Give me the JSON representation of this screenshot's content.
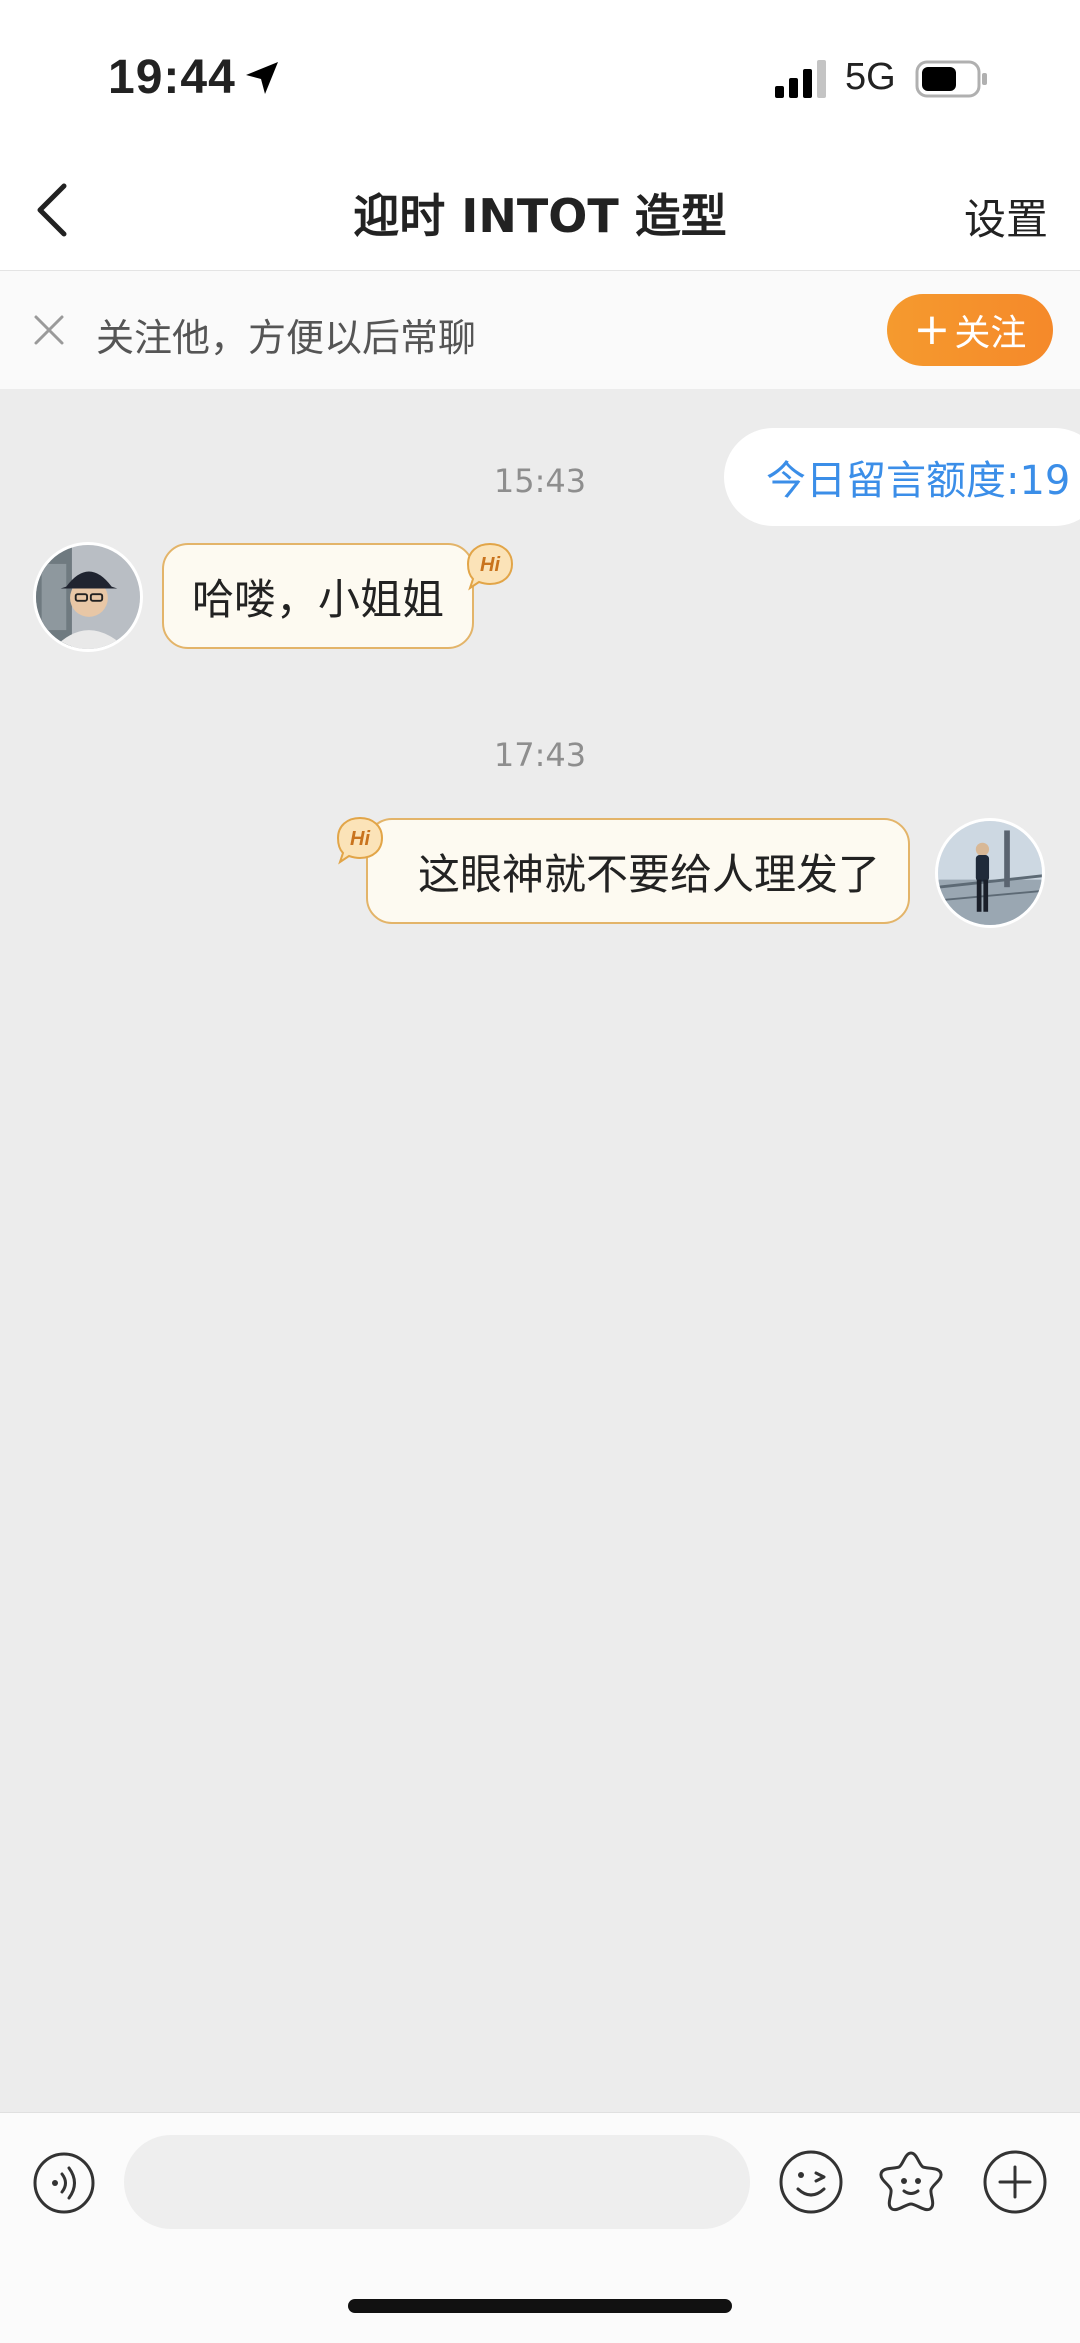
{
  "status_bar": {
    "time": "19:44",
    "network": "5G",
    "icons": [
      "location-arrow-icon",
      "signal-icon",
      "battery-icon"
    ]
  },
  "nav": {
    "title": "迎时 INTOT 造型",
    "settings_label": "设置",
    "back_icon": "chevron-left-icon"
  },
  "follow_bar": {
    "text": "关注他，方便以后常聊",
    "button_plus": "+",
    "button_label": "关注",
    "close_icon": "close-icon",
    "accent_color": "#F5912C"
  },
  "quota": {
    "text": "今日留言额度:19",
    "color": "#3B8EE8"
  },
  "messages": [
    {
      "timestamp": "15:43",
      "side": "left",
      "text": "哈喽，小姐姐",
      "badge": "Hi"
    },
    {
      "timestamp": "17:43",
      "side": "right",
      "text": "这眼神就不要给人理发了",
      "badge": "Hi"
    }
  ],
  "input_bar": {
    "placeholder": "",
    "icons": [
      "voice-icon",
      "emoji-icon",
      "sticker-icon",
      "plus-icon"
    ]
  }
}
